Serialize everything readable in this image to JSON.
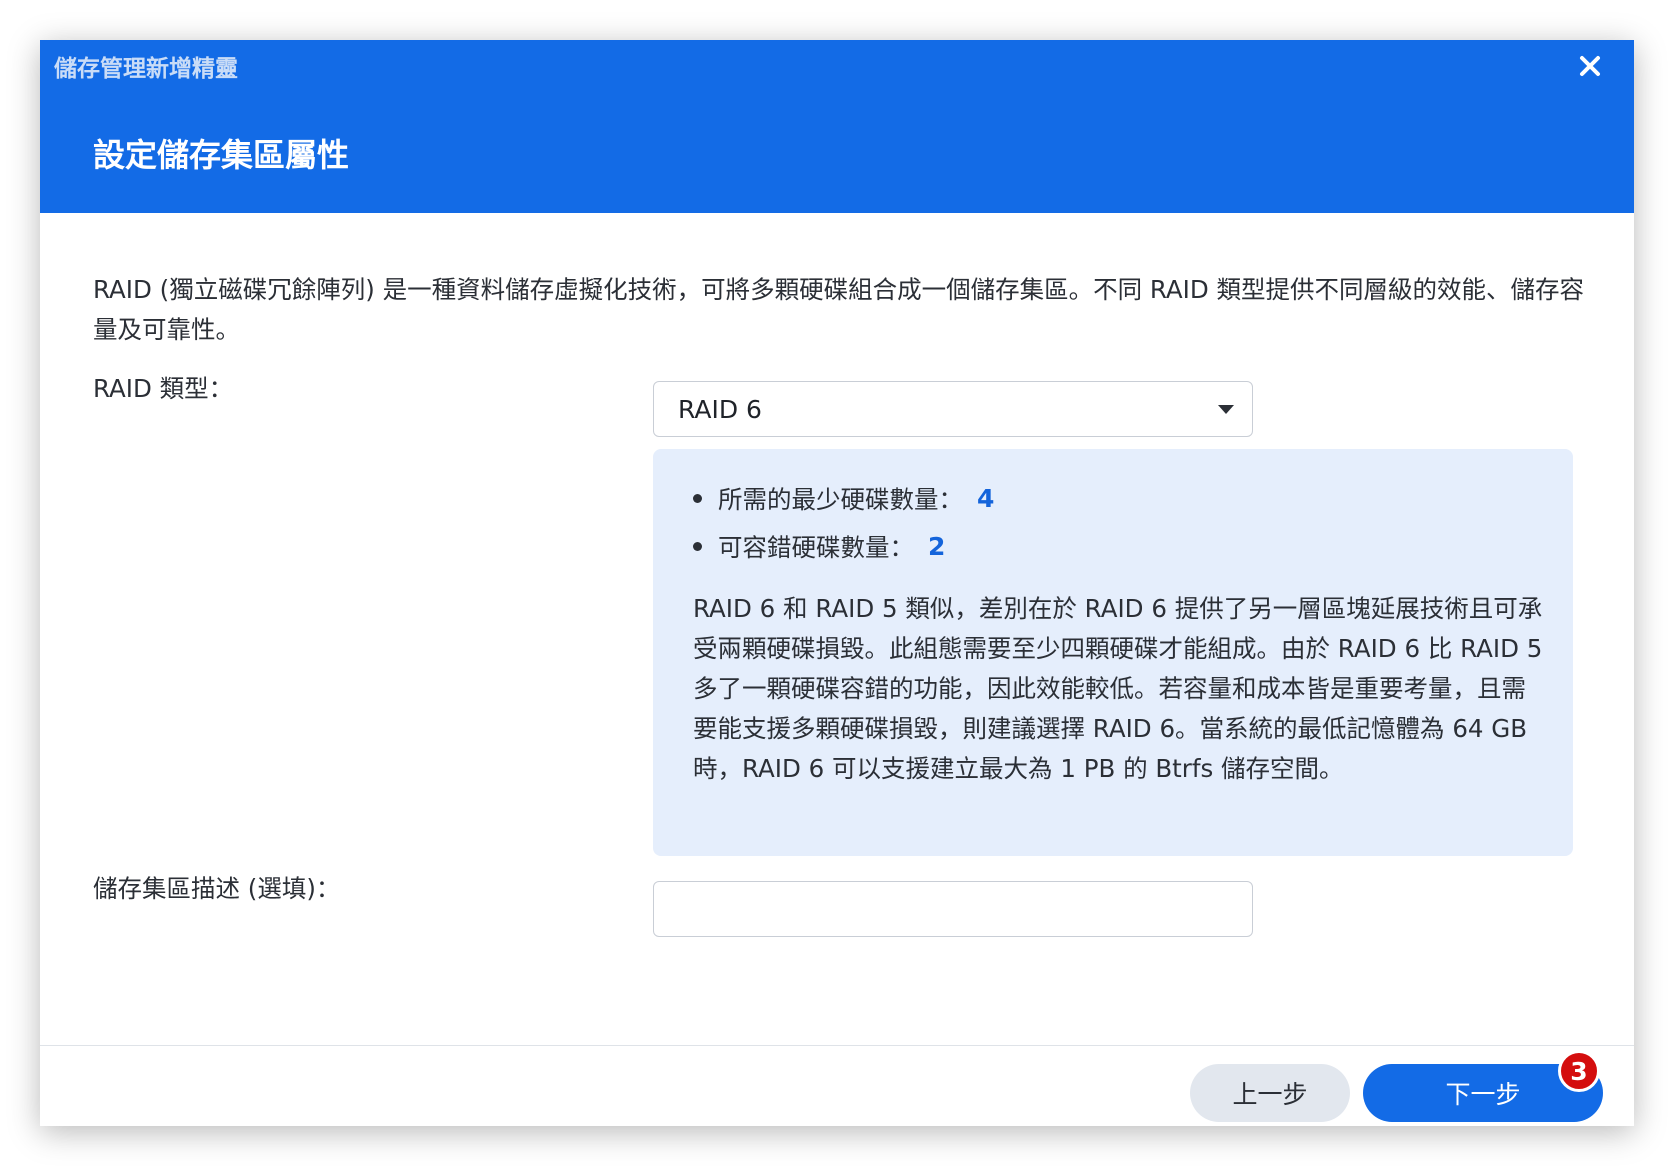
{
  "window": {
    "title": "儲存管理新增精靈",
    "page_title": "設定儲存集區屬性"
  },
  "intro_text": "RAID (獨立磁碟冗餘陣列) 是一種資料儲存虛擬化技術，可將多顆硬碟組合成一個儲存集區。不同 RAID 類型提供不同層級的效能、儲存容量及可靠性。",
  "raid_type": {
    "label": "RAID 類型：",
    "selected": "RAID 6"
  },
  "raid_info": {
    "min_disks_label": "所需的最少硬碟數量：",
    "min_disks_value": "4",
    "fault_tolerance_label": "可容錯硬碟數量：",
    "fault_tolerance_value": "2",
    "description": "RAID 6 和 RAID 5 類似，差別在於 RAID 6 提供了另一層區塊延展技術且可承受兩顆硬碟損毀。此組態需要至少四顆硬碟才能組成。由於 RAID 6 比 RAID 5 多了一顆硬碟容錯的功能，因此效能較低。若容量和成本皆是重要考量，且需要能支援多顆硬碟損毀，則建議選擇 RAID 6。當系統的最低記憶體為 64 GB 時，RAID 6 可以支援建立最大為 1 PB 的 Btrfs 儲存空間。"
  },
  "description_field": {
    "label": "儲存集區描述 (選填)：",
    "value": "",
    "placeholder": ""
  },
  "footer": {
    "back_label": "上一步",
    "next_label": "下一步",
    "badge": "3"
  },
  "icons": {
    "close": "close-icon",
    "caret": "caret-down-icon"
  },
  "colors": {
    "header": "#136be6",
    "info_bg": "#e5eefc",
    "accent": "#1464db",
    "badge": "#d40e0e"
  }
}
